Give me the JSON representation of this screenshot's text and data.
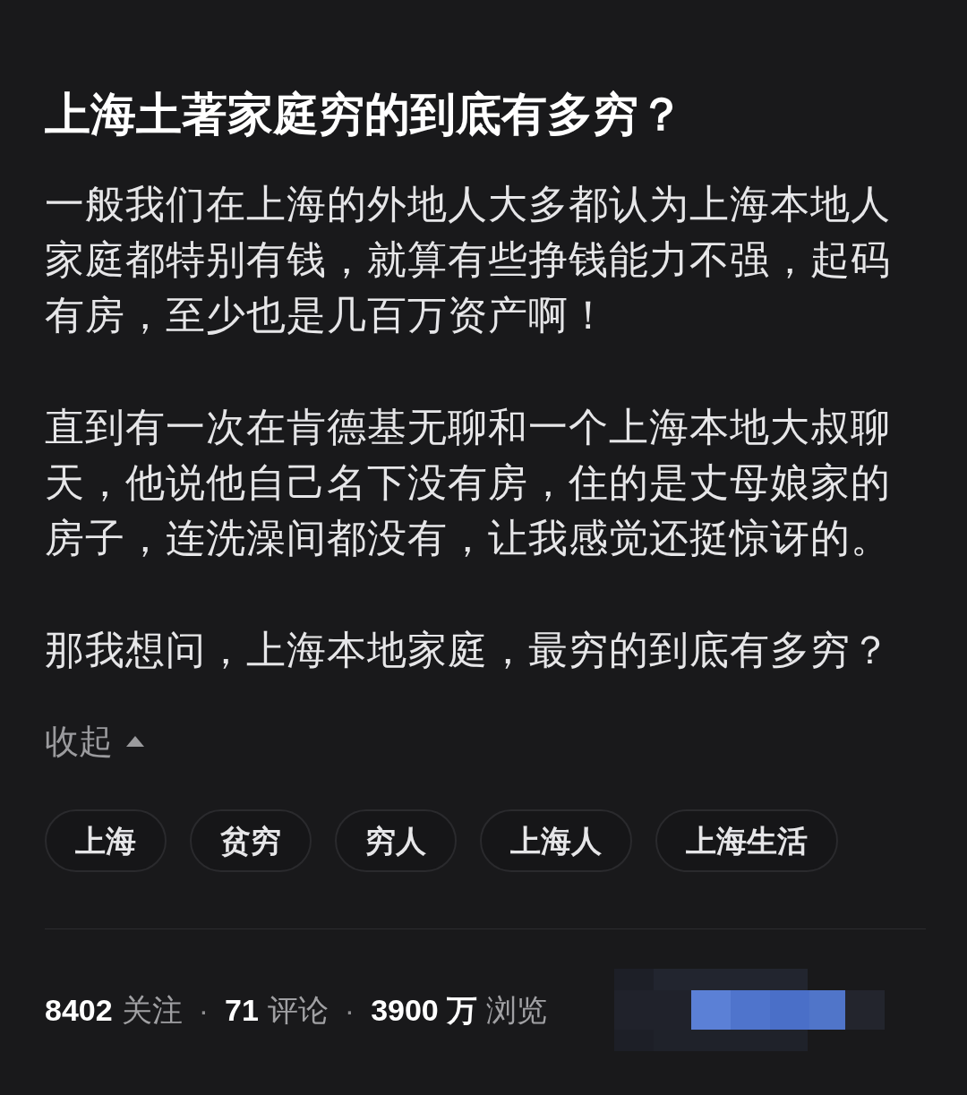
{
  "question": {
    "title": "上海土著家庭穷的到底有多穷？",
    "paragraphs": [
      "一般我们在上海的外地人大多都认为上海本地人家庭都特别有钱，就算有些挣钱能力不强，起码有房，至少也是几百万资产啊！",
      "直到有一次在肯德基无聊和一个上海本地大叔聊天，他说他自己名下没有房，住的是丈母娘家的房子，连洗澡间都没有，让我感觉还挺惊讶的。",
      "那我想问，上海本地家庭，最穷的到底有多穷？"
    ],
    "collapse": {
      "label": "收起",
      "expanded": true
    },
    "tags": [
      "上海",
      "贫穷",
      "穷人",
      "上海人",
      "上海生活"
    ],
    "stats": [
      {
        "number": "8402",
        "label": "关注"
      },
      {
        "number": "71",
        "label": "评论"
      },
      {
        "number": "3900 万",
        "label": "浏览"
      }
    ],
    "separator": "·"
  }
}
